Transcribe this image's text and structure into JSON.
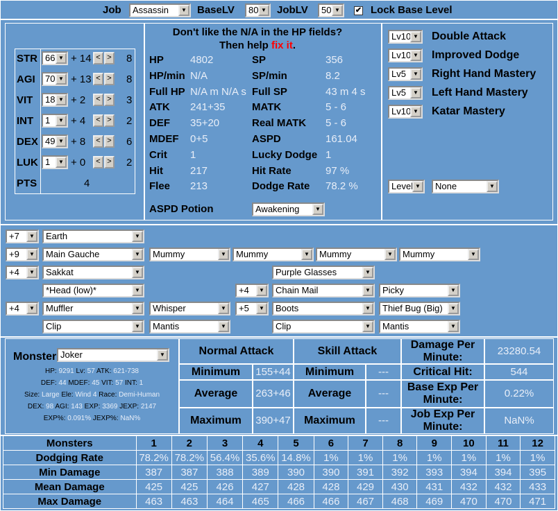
{
  "top": {
    "job_label": "Job",
    "job_value": "Assassin",
    "baselv_label": "BaseLV",
    "baselv_value": "80",
    "joblv_label": "JobLV",
    "joblv_value": "50",
    "lock_label": "Lock Base Level",
    "lock_checked": true
  },
  "stats": [
    {
      "name": "STR",
      "value": "66",
      "bonus": "+ 14",
      "cost": "8"
    },
    {
      "name": "AGI",
      "value": "70",
      "bonus": "+ 13",
      "cost": "8"
    },
    {
      "name": "VIT",
      "value": "18",
      "bonus": "+ 2",
      "cost": "3"
    },
    {
      "name": "INT",
      "value": "1",
      "bonus": "+ 4",
      "cost": "2"
    },
    {
      "name": "DEX",
      "value": "49",
      "bonus": "+ 8",
      "cost": "6"
    },
    {
      "name": "LUK",
      "value": "1",
      "bonus": "+ 0",
      "cost": "2"
    }
  ],
  "pts": {
    "label": "PTS",
    "value": "4"
  },
  "notice": {
    "line1": "Don't like the N/A in the HP fields?",
    "line2": "Then help ",
    "link": "fix it",
    "end": "."
  },
  "left_stats": [
    {
      "label": "HP",
      "value": "4802"
    },
    {
      "label": "HP/min",
      "value": "N/A"
    },
    {
      "label": "Full HP",
      "value": "N/A m N/A s"
    },
    {
      "label": "ATK",
      "value": "241+35"
    },
    {
      "label": "DEF",
      "value": "35+20"
    },
    {
      "label": "MDEF",
      "value": "0+5"
    },
    {
      "label": "Crit",
      "value": "1"
    },
    {
      "label": "Hit",
      "value": "217"
    },
    {
      "label": "Flee",
      "value": "213"
    }
  ],
  "right_stats": [
    {
      "label": "SP",
      "value": "356"
    },
    {
      "label": "SP/min",
      "value": "8.2"
    },
    {
      "label": "Full SP",
      "value": "43 m 4 s"
    },
    {
      "label": "MATK",
      "value": "5 - 6"
    },
    {
      "label": "Real MATK",
      "value": "5 - 6"
    },
    {
      "label": "ASPD",
      "value": "161.04"
    },
    {
      "label": "Lucky Dodge",
      "value": "1"
    },
    {
      "label": "Hit Rate",
      "value": "97 %"
    },
    {
      "label": "Dodge Rate",
      "value": "78.2 %"
    }
  ],
  "aspd_potion": {
    "label": "ASPD Potion",
    "value": "Awakening"
  },
  "skills": [
    {
      "level": "Lv10",
      "name": "Double Attack"
    },
    {
      "level": "Lv10",
      "name": "Improved Dodge"
    },
    {
      "level": "Lv5",
      "name": "Right Hand Mastery"
    },
    {
      "level": "Lv5",
      "name": "Left Hand Mastery"
    },
    {
      "level": "Lv10",
      "name": "Katar Mastery"
    }
  ],
  "extra": {
    "level": "Level",
    "none": "None"
  },
  "equip": {
    "r1": {
      "refine": "+7",
      "item": "Earth"
    },
    "r2": {
      "refine": "+9",
      "item": "Main Gauche",
      "cards": [
        "Mummy",
        "Mummy",
        "Mummy",
        "Mummy"
      ]
    },
    "r3": {
      "refine": "+4",
      "item": "Sakkat",
      "mid": "Purple Glasses"
    },
    "r4": {
      "item": "*Head (low)*",
      "refine2": "+4",
      "armor": "Chain Mail",
      "card": "Picky"
    },
    "r5": {
      "refine": "+4",
      "item": "Muffler",
      "card": "Whisper",
      "refine2": "+5",
      "shoes": "Boots",
      "card2": "Thief Bug (Big)"
    },
    "r6": {
      "item": "Clip",
      "card": "Mantis",
      "item2": "Clip",
      "card2": "Mantis"
    }
  },
  "monster": {
    "label": "Monster",
    "value": "Joker",
    "line1": [
      {
        "k": "HP:",
        "v": "9291"
      },
      {
        "k": "Lv:",
        "v": "57"
      },
      {
        "k": "ATK:",
        "v": "621-738"
      }
    ],
    "line2": [
      {
        "k": "DEF:",
        "v": "44"
      },
      {
        "k": "MDEF:",
        "v": "45"
      },
      {
        "k": "VIT:",
        "v": "57"
      },
      {
        "k": "INT:",
        "v": "1"
      }
    ],
    "line3": [
      {
        "k": "Size:",
        "v": "Large"
      },
      {
        "k": "Ele:",
        "v": "Wind 4"
      },
      {
        "k": "Race:",
        "v": "Demi-Human"
      }
    ],
    "line4": [
      {
        "k": "DEX:",
        "v": "98"
      },
      {
        "k": "AGI:",
        "v": "143"
      },
      {
        "k": "EXP:",
        "v": "3369"
      },
      {
        "k": "JEXP:",
        "v": "2147"
      }
    ],
    "line5": [
      {
        "k": "EXP%:",
        "v": "0.091%"
      },
      {
        "k": "JEXP%:",
        "v": "NaN%"
      }
    ]
  },
  "attack": {
    "normal_header": "Normal Attack",
    "skill_header": "Skill Attack",
    "min_label": "Minimum",
    "avg_label": "Average",
    "max_label": "Maximum",
    "normal_min": "155+44",
    "normal_avg": "263+46",
    "normal_max": "390+47",
    "skill_min": "---",
    "skill_avg": "---",
    "skill_max": "---",
    "dpm_label": "Damage Per Minute:",
    "dpm_value": "23280.54",
    "crit_label": "Critical Hit:",
    "crit_value": "544",
    "bexp_label": "Base Exp Per Minute:",
    "bexp_value": "0.22%",
    "jexp_label": "Job Exp Per Minute:",
    "jexp_value": "NaN%"
  },
  "table": {
    "header": "Monsters",
    "cols": [
      "1",
      "2",
      "3",
      "4",
      "5",
      "6",
      "7",
      "8",
      "9",
      "10",
      "11",
      "12"
    ],
    "rows": [
      {
        "label": "Dodging Rate",
        "values": [
          "78.2%",
          "78.2%",
          "56.4%",
          "35.6%",
          "14.8%",
          "1%",
          "1%",
          "1%",
          "1%",
          "1%",
          "1%",
          "1%"
        ]
      },
      {
        "label": "Min Damage",
        "values": [
          "387",
          "387",
          "388",
          "389",
          "390",
          "390",
          "391",
          "392",
          "393",
          "394",
          "394",
          "395"
        ]
      },
      {
        "label": "Mean Damage",
        "values": [
          "425",
          "425",
          "426",
          "427",
          "428",
          "428",
          "429",
          "430",
          "431",
          "432",
          "432",
          "433"
        ]
      },
      {
        "label": "Max Damage",
        "values": [
          "463",
          "463",
          "464",
          "465",
          "466",
          "466",
          "467",
          "468",
          "469",
          "470",
          "470",
          "471"
        ]
      }
    ]
  }
}
